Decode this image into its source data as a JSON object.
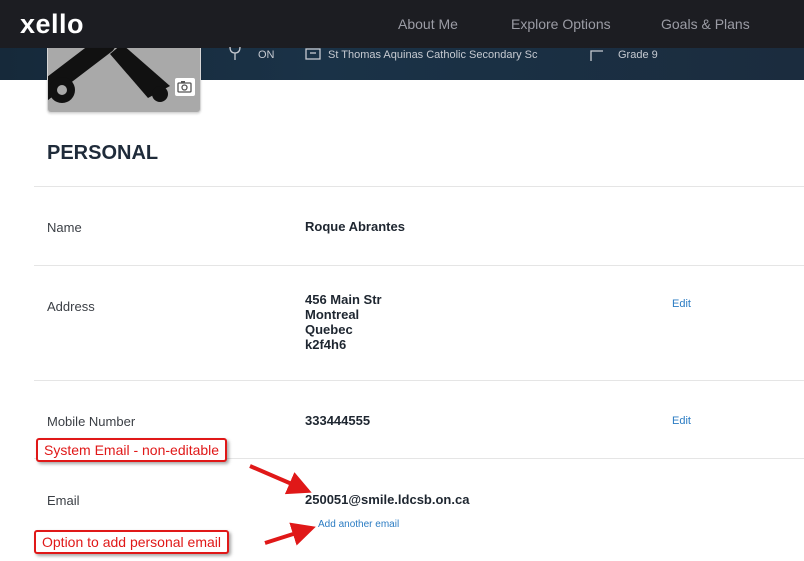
{
  "app": {
    "logo": "xello"
  },
  "nav": {
    "items": [
      {
        "label": "About Me"
      },
      {
        "label": "Explore Options"
      },
      {
        "label": "Goals & Plans"
      }
    ]
  },
  "profile": {
    "province": "ON",
    "school": "St Thomas Aquinas Catholic Secondary Sc",
    "grade": "Grade 9"
  },
  "personal": {
    "title": "PERSONAL",
    "name": {
      "label": "Name",
      "value": "Roque Abrantes"
    },
    "address": {
      "label": "Address",
      "lines": [
        "456 Main Str",
        "Montreal",
        "Quebec",
        "k2f4h6"
      ],
      "edit_label": "Edit"
    },
    "mobile": {
      "label": "Mobile Number",
      "value": "333444555",
      "edit_label": "Edit"
    },
    "email": {
      "label": "Email",
      "value": "250051@smile.ldcsb.on.ca",
      "add_label": "Add another email"
    }
  },
  "annotations": {
    "system_email": "System Email - non-editable",
    "add_personal": "Option to add personal email",
    "color": "#e01818"
  }
}
